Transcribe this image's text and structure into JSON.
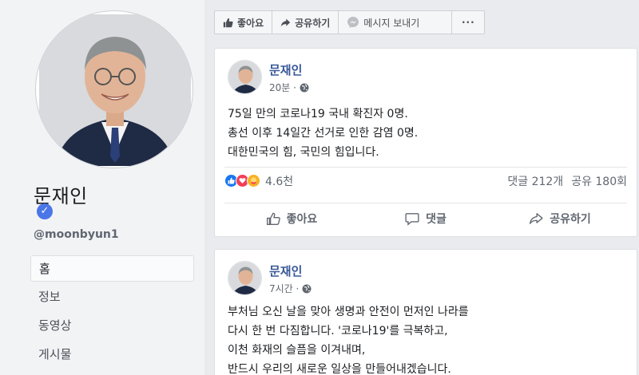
{
  "profile": {
    "name": "문재인",
    "verified": "✓",
    "username": "@moonbyun1"
  },
  "nav": {
    "items": [
      {
        "label": "홈",
        "active": true
      },
      {
        "label": "정보",
        "active": false
      },
      {
        "label": "동영상",
        "active": false
      },
      {
        "label": "게시물",
        "active": false
      }
    ]
  },
  "action_bar": {
    "like_label": "좋아요",
    "share_label": "공유하기",
    "message_label": "메시지 보내기",
    "more_label": "···"
  },
  "posts": [
    {
      "author": "문재인",
      "time": "20분 ·",
      "lines": [
        "75일 만의 코로나19 국내 확진자 0명.",
        "총선 이후 14일간 선거로 인한 감염 0명.",
        "대한민국의 힘, 국민의 힘입니다."
      ],
      "reaction_count": "4.6천",
      "comments": "댓글 212개",
      "shares": "공유 180회",
      "like_label": "좋아요",
      "comment_label": "댓글",
      "share_label": "공유하기"
    },
    {
      "author": "문재인",
      "time": "7시간 ·",
      "lines": [
        "부처님 오신 날을 맞아 생명과 안전이 먼저인 나라를",
        "다시 한 번 다짐합니다. '코로나19'를 극복하고,",
        "이천 화재의 슬픔을 이겨내며,",
        "반드시 우리의 새로운 일상을 만들어내겠습니다."
      ]
    }
  ],
  "colors": {
    "link": "#385898",
    "verified": "#4a76e8",
    "like_reaction": "#1877f2",
    "love_reaction": "#f33e58",
    "care_reaction": "#f7b125"
  }
}
